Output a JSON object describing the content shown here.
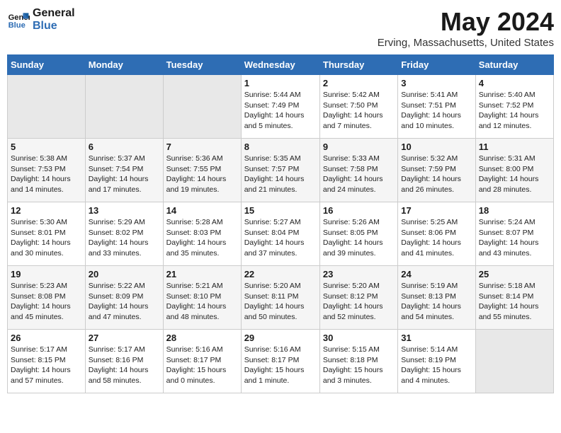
{
  "logo": {
    "line1": "General",
    "line2": "Blue"
  },
  "title": "May 2024",
  "subtitle": "Erving, Massachusetts, United States",
  "days_of_week": [
    "Sunday",
    "Monday",
    "Tuesday",
    "Wednesday",
    "Thursday",
    "Friday",
    "Saturday"
  ],
  "weeks": [
    [
      {
        "day": "",
        "info": ""
      },
      {
        "day": "",
        "info": ""
      },
      {
        "day": "",
        "info": ""
      },
      {
        "day": "1",
        "info": "Sunrise: 5:44 AM\nSunset: 7:49 PM\nDaylight: 14 hours\nand 5 minutes."
      },
      {
        "day": "2",
        "info": "Sunrise: 5:42 AM\nSunset: 7:50 PM\nDaylight: 14 hours\nand 7 minutes."
      },
      {
        "day": "3",
        "info": "Sunrise: 5:41 AM\nSunset: 7:51 PM\nDaylight: 14 hours\nand 10 minutes."
      },
      {
        "day": "4",
        "info": "Sunrise: 5:40 AM\nSunset: 7:52 PM\nDaylight: 14 hours\nand 12 minutes."
      }
    ],
    [
      {
        "day": "5",
        "info": "Sunrise: 5:38 AM\nSunset: 7:53 PM\nDaylight: 14 hours\nand 14 minutes."
      },
      {
        "day": "6",
        "info": "Sunrise: 5:37 AM\nSunset: 7:54 PM\nDaylight: 14 hours\nand 17 minutes."
      },
      {
        "day": "7",
        "info": "Sunrise: 5:36 AM\nSunset: 7:55 PM\nDaylight: 14 hours\nand 19 minutes."
      },
      {
        "day": "8",
        "info": "Sunrise: 5:35 AM\nSunset: 7:57 PM\nDaylight: 14 hours\nand 21 minutes."
      },
      {
        "day": "9",
        "info": "Sunrise: 5:33 AM\nSunset: 7:58 PM\nDaylight: 14 hours\nand 24 minutes."
      },
      {
        "day": "10",
        "info": "Sunrise: 5:32 AM\nSunset: 7:59 PM\nDaylight: 14 hours\nand 26 minutes."
      },
      {
        "day": "11",
        "info": "Sunrise: 5:31 AM\nSunset: 8:00 PM\nDaylight: 14 hours\nand 28 minutes."
      }
    ],
    [
      {
        "day": "12",
        "info": "Sunrise: 5:30 AM\nSunset: 8:01 PM\nDaylight: 14 hours\nand 30 minutes."
      },
      {
        "day": "13",
        "info": "Sunrise: 5:29 AM\nSunset: 8:02 PM\nDaylight: 14 hours\nand 33 minutes."
      },
      {
        "day": "14",
        "info": "Sunrise: 5:28 AM\nSunset: 8:03 PM\nDaylight: 14 hours\nand 35 minutes."
      },
      {
        "day": "15",
        "info": "Sunrise: 5:27 AM\nSunset: 8:04 PM\nDaylight: 14 hours\nand 37 minutes."
      },
      {
        "day": "16",
        "info": "Sunrise: 5:26 AM\nSunset: 8:05 PM\nDaylight: 14 hours\nand 39 minutes."
      },
      {
        "day": "17",
        "info": "Sunrise: 5:25 AM\nSunset: 8:06 PM\nDaylight: 14 hours\nand 41 minutes."
      },
      {
        "day": "18",
        "info": "Sunrise: 5:24 AM\nSunset: 8:07 PM\nDaylight: 14 hours\nand 43 minutes."
      }
    ],
    [
      {
        "day": "19",
        "info": "Sunrise: 5:23 AM\nSunset: 8:08 PM\nDaylight: 14 hours\nand 45 minutes."
      },
      {
        "day": "20",
        "info": "Sunrise: 5:22 AM\nSunset: 8:09 PM\nDaylight: 14 hours\nand 47 minutes."
      },
      {
        "day": "21",
        "info": "Sunrise: 5:21 AM\nSunset: 8:10 PM\nDaylight: 14 hours\nand 48 minutes."
      },
      {
        "day": "22",
        "info": "Sunrise: 5:20 AM\nSunset: 8:11 PM\nDaylight: 14 hours\nand 50 minutes."
      },
      {
        "day": "23",
        "info": "Sunrise: 5:20 AM\nSunset: 8:12 PM\nDaylight: 14 hours\nand 52 minutes."
      },
      {
        "day": "24",
        "info": "Sunrise: 5:19 AM\nSunset: 8:13 PM\nDaylight: 14 hours\nand 54 minutes."
      },
      {
        "day": "25",
        "info": "Sunrise: 5:18 AM\nSunset: 8:14 PM\nDaylight: 14 hours\nand 55 minutes."
      }
    ],
    [
      {
        "day": "26",
        "info": "Sunrise: 5:17 AM\nSunset: 8:15 PM\nDaylight: 14 hours\nand 57 minutes."
      },
      {
        "day": "27",
        "info": "Sunrise: 5:17 AM\nSunset: 8:16 PM\nDaylight: 14 hours\nand 58 minutes."
      },
      {
        "day": "28",
        "info": "Sunrise: 5:16 AM\nSunset: 8:17 PM\nDaylight: 15 hours\nand 0 minutes."
      },
      {
        "day": "29",
        "info": "Sunrise: 5:16 AM\nSunset: 8:17 PM\nDaylight: 15 hours\nand 1 minute."
      },
      {
        "day": "30",
        "info": "Sunrise: 5:15 AM\nSunset: 8:18 PM\nDaylight: 15 hours\nand 3 minutes."
      },
      {
        "day": "31",
        "info": "Sunrise: 5:14 AM\nSunset: 8:19 PM\nDaylight: 15 hours\nand 4 minutes."
      },
      {
        "day": "",
        "info": ""
      }
    ]
  ]
}
